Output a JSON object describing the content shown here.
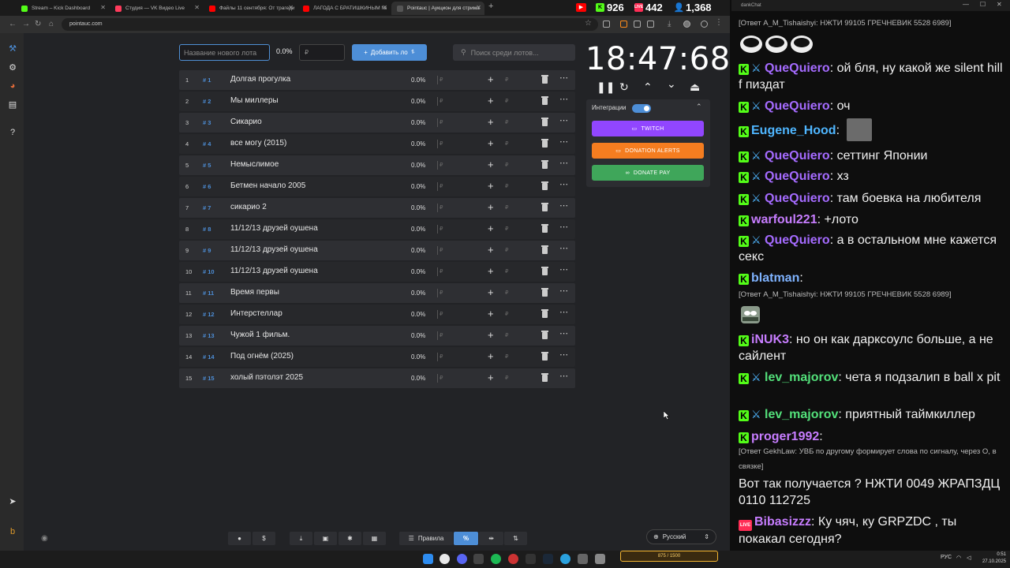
{
  "browser": {
    "tabs": [
      {
        "title": "Stream – Kick Dashboard",
        "color": "#53fc18"
      },
      {
        "title": "Студия — VK Видео Live",
        "color": "#ff3b5c"
      },
      {
        "title": "Файлы 11 сентября: От трагедии",
        "color": "#ff0000"
      },
      {
        "title": "ЛАГОДА С БРАТИШКИНЫМ №",
        "color": "#ff0000"
      },
      {
        "title": "Pointauc | Аукцион для стрима",
        "color": "#555555"
      }
    ],
    "stats": {
      "youtube": "926",
      "kick": "926",
      "vk": "442",
      "viewers": "1,368"
    },
    "url": "pointauc.com"
  },
  "toolbar": {
    "new_lot_placeholder": "Название нового лота",
    "percent": "0.0%",
    "price_placeholder": "₽",
    "add_label": "Добавить ло",
    "search_placeholder": "Поиск среди лотов..."
  },
  "lots": [
    {
      "index": "1",
      "id": "# 1",
      "name": "Долгая прогулка",
      "percent": "0.0%"
    },
    {
      "index": "2",
      "id": "# 2",
      "name": "Мы миллеры",
      "percent": "0.0%"
    },
    {
      "index": "3",
      "id": "# 3",
      "name": "Сикарио",
      "percent": "0.0%"
    },
    {
      "index": "4",
      "id": "# 4",
      "name": "все могу (2015)",
      "percent": "0.0%"
    },
    {
      "index": "5",
      "id": "# 5",
      "name": "Немыслимое",
      "percent": "0.0%"
    },
    {
      "index": "6",
      "id": "# 6",
      "name": "Бетмен начало 2005",
      "percent": "0.0%"
    },
    {
      "index": "7",
      "id": "# 7",
      "name": "сикарио 2",
      "percent": "0.0%"
    },
    {
      "index": "8",
      "id": "# 8",
      "name": "11/12/13 друзей оушена",
      "percent": "0.0%"
    },
    {
      "index": "9",
      "id": "# 9",
      "name": "11/12/13 друзей оушена",
      "percent": "0.0%"
    },
    {
      "index": "10",
      "id": "# 10",
      "name": "11/12/13 друзей оушена",
      "percent": "0.0%"
    },
    {
      "index": "11",
      "id": "# 11",
      "name": "Время первы",
      "percent": "0.0%"
    },
    {
      "index": "12",
      "id": "# 12",
      "name": "Интерстеллар",
      "percent": "0.0%"
    },
    {
      "index": "13",
      "id": "# 13",
      "name": "Чужой 1 фильм.",
      "percent": "0.0%"
    },
    {
      "index": "14",
      "id": "# 14",
      "name": "Под огнём (2025)",
      "percent": "0.0%"
    },
    {
      "index": "15",
      "id": "# 15",
      "name": "холый пэтолэт 2025",
      "percent": "0.0%"
    }
  ],
  "currency_symbol": "₽",
  "timer": "18:47:68",
  "integrations": {
    "label": "Интеграции",
    "twitch": "TWITCH",
    "donation_alerts": "DONATION ALERTS",
    "donate_pay": "DONATE PAY"
  },
  "bottom": {
    "rules_label": "Правила",
    "percent_symbol": "%",
    "language": "Русский"
  },
  "chat": {
    "window_title": "dankChat",
    "messages": [
      {
        "type": "reply",
        "text": "[Ответ A_M_Tishaishyi: НЖТИ 99105 ГРЕЧНЕВИК 5528 6989]"
      },
      {
        "type": "msg",
        "user": "QueQuiero",
        "color": "#a56bff",
        "text": "ой бля, ну какой же silent hill f пиздат"
      },
      {
        "type": "msg",
        "user": "QueQuiero",
        "color": "#a56bff",
        "text": "оч"
      },
      {
        "type": "msg",
        "user": "Eugene_Hood",
        "color": "#4fb6ff",
        "text": ""
      },
      {
        "type": "msg",
        "user": "QueQuiero",
        "color": "#a56bff",
        "text": "сеттинг Японии"
      },
      {
        "type": "msg",
        "user": "QueQuiero",
        "color": "#a56bff",
        "text": "хз"
      },
      {
        "type": "msg",
        "user": "QueQuiero",
        "color": "#a56bff",
        "text": "там боевка на любителя"
      },
      {
        "type": "msg",
        "user": "warfoul221",
        "color": "#c77dff",
        "text": "+лото"
      },
      {
        "type": "msg",
        "user": "QueQuiero",
        "color": "#a56bff",
        "text": "а в остальном мне кажется секс"
      },
      {
        "type": "msg",
        "user": "blatman",
        "color": "#7fb3ff",
        "text": ""
      },
      {
        "type": "reply",
        "text": "[Ответ A_M_Tishaishyi: НЖТИ 99105 ГРЕЧНЕВИК 5528 6989]"
      },
      {
        "type": "msg",
        "user": "iNUK3",
        "color": "#c77dff",
        "text": "но он как дарксоулс больше, а не сайлент"
      },
      {
        "type": "msg",
        "user": "lev_majorov",
        "color": "#53e07a",
        "text": "чета я подзалип в ball x pit"
      },
      {
        "type": "msg",
        "user": "lev_majorov",
        "color": "#53e07a",
        "text": "приятный таймкиллер"
      },
      {
        "type": "msg",
        "user": "proger1992",
        "color": "#c77dff",
        "text": ""
      },
      {
        "type": "reply",
        "text": "[Ответ GekhLaw: УВБ по другому формирует слова по сигналу, через О, в связке]"
      },
      {
        "type": "plain",
        "text": "Вот так получается ? НЖТИ 0049 ЖРАПЗДЦ 0110 112725"
      },
      {
        "type": "msg",
        "user": "Bibasizzz",
        "color": "#c77dff",
        "text": "Ку чяч, ку GRPZDC , ты покакал сегодня?"
      }
    ]
  },
  "taskbar": {
    "lang": "РУС",
    "time": "0:51",
    "date": "27.10.2025",
    "game_counter": "875 / 1500"
  }
}
